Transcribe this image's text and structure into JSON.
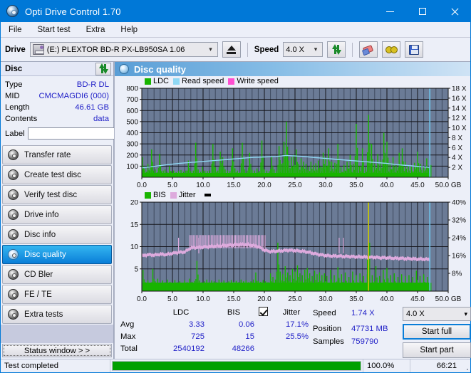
{
  "window": {
    "title": "Opti Drive Control 1.70",
    "icon": "optical-disc-icon",
    "minimize": "minimize",
    "maximize": "maximize",
    "close": "close"
  },
  "menu": {
    "items": [
      "File",
      "Start test",
      "Extra",
      "Help"
    ]
  },
  "toolbar": {
    "drive_label": "Drive",
    "drive_value": "(E:)   PLEXTOR BD-R  PX-LB950SA 1.06",
    "eject_title": "eject",
    "speed_label": "Speed",
    "speed_value": "4.0 X",
    "refresh_title": "refresh",
    "erase_title": "erase",
    "glasses_title": "bookmark",
    "save_title": "save"
  },
  "disc": {
    "header": "Disc",
    "refresh_title": "refresh-disc",
    "fields": [
      {
        "key": "Type",
        "value": "BD-R DL"
      },
      {
        "key": "MID",
        "value": "CMCMAGDI6 (000)"
      },
      {
        "key": "Length",
        "value": "46.61 GB"
      },
      {
        "key": "Contents",
        "value": "data"
      }
    ],
    "label_key": "Label",
    "label_value": "",
    "label_placeholder": ""
  },
  "nav": {
    "items": [
      {
        "label": "Transfer rate",
        "active": false
      },
      {
        "label": "Create test disc",
        "active": false
      },
      {
        "label": "Verify test disc",
        "active": false
      },
      {
        "label": "Drive info",
        "active": false
      },
      {
        "label": "Disc info",
        "active": false
      },
      {
        "label": "Disc quality",
        "active": true
      },
      {
        "label": "CD Bler",
        "active": false
      },
      {
        "label": "FE / TE",
        "active": false
      },
      {
        "label": "Extra tests",
        "active": false
      }
    ],
    "status_window": "Status window > >"
  },
  "panel": {
    "title": "Disc quality",
    "icon": "disc-quality-icon"
  },
  "colors": {
    "ldc": "#18b400",
    "bis": "#18b400",
    "read_speed": "#8fd8f4",
    "write_speed": "#ff4fd0",
    "jitter": "#ddaadd",
    "plot_bg": "#6b7b96",
    "grid": "#2a2a2a",
    "accent": "#0078d7",
    "value_text": "#2323c8",
    "progress": "#00a000"
  },
  "chart_data": [
    {
      "type": "area",
      "name": "ldc-chart",
      "title": "",
      "legend": [
        {
          "label": "LDC",
          "color": "#18b400"
        },
        {
          "label": "Read speed",
          "color": "#8fd8f4"
        },
        {
          "label": "Write speed",
          "color": "#ff4fd0"
        }
      ],
      "legend_position": "top-left",
      "xlabel": "GB",
      "ylabel": "",
      "xlim": [
        0,
        50
      ],
      "ylim": [
        0,
        800
      ],
      "y2lim": [
        0,
        18
      ],
      "xticks": [
        0.0,
        5.0,
        10.0,
        15.0,
        20.0,
        25.0,
        30.0,
        35.0,
        40.0,
        45.0,
        50.0
      ],
      "xticklabels": [
        "0.0",
        "5.0",
        "10.0",
        "15.0",
        "20.0",
        "25.0",
        "30.0",
        "35.0",
        "40.0",
        "45.0",
        "50.0 GB"
      ],
      "yticks": [
        100,
        200,
        300,
        400,
        500,
        600,
        700,
        800
      ],
      "yticklabels": [
        "100",
        "200",
        "300",
        "400",
        "500",
        "600",
        "700",
        "800"
      ],
      "y2ticks": [
        2,
        4,
        6,
        8,
        10,
        12,
        14,
        16,
        18
      ],
      "y2ticklabels": [
        "2 X",
        "4 X",
        "6 X",
        "8 X",
        "10 X",
        "12 X",
        "14 X",
        "16 X",
        "18 X"
      ],
      "grid": true,
      "data_end_gb": 47.0,
      "series": [
        {
          "name": "LDC",
          "color": "#18b400",
          "axis": "left",
          "kind": "spikes",
          "x": [
            0.1,
            0.3,
            0.5,
            0.8,
            1.0,
            1.3,
            1.6,
            1.9,
            2.2,
            2.5,
            2.9,
            3.2,
            3.5,
            3.8,
            4.1,
            4.5,
            4.8,
            5.2,
            5.6,
            6.0,
            6.4,
            6.8,
            7.2,
            7.6,
            8.0,
            8.4,
            8.8,
            9.2,
            9.6,
            9.9,
            10.3,
            10.7,
            11.1,
            11.6,
            12.0,
            12.4,
            12.8,
            13.2,
            13.6,
            14.0,
            14.4,
            14.8,
            15.2,
            15.6,
            16.0,
            16.4,
            16.8,
            17.2,
            17.6,
            18.0,
            18.4,
            18.8,
            19.2,
            19.6,
            20.0,
            20.4,
            20.8,
            21.2,
            21.6,
            22.0,
            22.4,
            22.8,
            23.2,
            23.6,
            24.0,
            24.4,
            24.8,
            25.2,
            25.6,
            26.0,
            26.4,
            26.8,
            27.2,
            27.6,
            28.0,
            28.4,
            28.8,
            29.2,
            29.6,
            30.0,
            30.5,
            31.0,
            31.5,
            32.0,
            32.5,
            33.0,
            33.5,
            34.0,
            34.5,
            35.0,
            35.5,
            36.0,
            36.5,
            37.0,
            37.5,
            38.0,
            38.5,
            39.0,
            39.5,
            40.0,
            40.5,
            41.0,
            41.5,
            42.0,
            42.5,
            43.0,
            43.5,
            44.0,
            44.5,
            45.0,
            45.5,
            46.0,
            46.5,
            47.0
          ],
          "y": [
            180,
            60,
            75,
            50,
            120,
            55,
            250,
            60,
            70,
            45,
            210,
            55,
            60,
            70,
            50,
            100,
            55,
            60,
            45,
            55,
            65,
            50,
            60,
            150,
            55,
            60,
            310,
            70,
            50,
            95,
            60,
            55,
            60,
            300,
            90,
            60,
            230,
            180,
            70,
            60,
            55,
            260,
            80,
            60,
            45,
            310,
            70,
            60,
            220,
            65,
            60,
            80,
            55,
            330,
            70,
            60,
            55,
            190,
            70,
            60,
            280,
            120,
            320,
            500,
            150,
            180,
            200,
            250,
            120,
            170,
            140,
            120,
            95,
            140,
            110,
            125,
            150,
            100,
            220,
            180,
            260,
            140,
            130,
            300,
            90,
            110,
            140,
            200,
            120,
            480,
            100,
            260,
            90,
            560,
            300,
            120,
            210,
            150,
            400,
            320,
            130,
            180,
            110,
            220,
            260,
            140,
            110,
            95,
            130,
            230,
            120,
            100,
            170,
            200
          ]
        },
        {
          "name": "Read speed",
          "color": "#8fd8f4",
          "axis": "right",
          "kind": "line",
          "x": [
            0.0,
            2.0,
            4.0,
            6.0,
            8.0,
            10.0,
            12.0,
            14.0,
            16.0,
            18.0,
            20.0,
            22.0,
            23.5,
            25.0,
            26.5,
            28.0,
            30.0,
            32.0,
            34.0,
            36.0,
            38.0,
            40.0,
            42.0,
            44.0,
            46.0,
            47.0
          ],
          "y": [
            1.9,
            2.2,
            2.5,
            2.8,
            3.0,
            3.2,
            3.4,
            3.6,
            3.8,
            4.0,
            4.1,
            4.2,
            4.4,
            4.3,
            4.2,
            4.0,
            3.8,
            3.6,
            3.4,
            3.2,
            3.0,
            2.8,
            2.5,
            2.3,
            2.1,
            2.0
          ]
        },
        {
          "name": "Write speed",
          "color": "#ff4fd0",
          "axis": "right",
          "kind": "line",
          "x": [],
          "y": []
        }
      ],
      "markers": [
        {
          "type": "vline",
          "x": 47.0,
          "color": "#6ec8ee"
        }
      ]
    },
    {
      "type": "area",
      "name": "bis-jitter-chart",
      "title": "",
      "legend": [
        {
          "label": "BIS",
          "color": "#18b400"
        },
        {
          "label": "Jitter",
          "color": "#ddaadd"
        }
      ],
      "legend_position": "top-left",
      "xlabel": "GB",
      "ylabel": "",
      "xlim": [
        0,
        50
      ],
      "ylim": [
        0,
        20
      ],
      "y2lim": [
        0,
        40
      ],
      "xticks": [
        0.0,
        5.0,
        10.0,
        15.0,
        20.0,
        25.0,
        30.0,
        35.0,
        40.0,
        45.0,
        50.0
      ],
      "xticklabels": [
        "0.0",
        "5.0",
        "10.0",
        "15.0",
        "20.0",
        "25.0",
        "30.0",
        "35.0",
        "40.0",
        "45.0",
        "50.0 GB"
      ],
      "yticks": [
        5,
        10,
        15,
        20
      ],
      "yticklabels": [
        "5",
        "10",
        "15",
        "20"
      ],
      "y2ticks": [
        8,
        16,
        24,
        32,
        40
      ],
      "y2ticklabels": [
        "8%",
        "16%",
        "24%",
        "32%",
        "40%"
      ],
      "grid": true,
      "data_end_gb": 47.0,
      "series": [
        {
          "name": "BIS",
          "color": "#18b400",
          "axis": "left",
          "kind": "spikes",
          "x": [
            0.2,
            0.6,
            1.0,
            1.4,
            1.8,
            2.2,
            2.6,
            3.0,
            3.4,
            3.8,
            4.2,
            4.6,
            5.0,
            5.4,
            5.8,
            6.2,
            6.6,
            7.0,
            7.4,
            7.8,
            8.2,
            8.6,
            9.0,
            9.4,
            9.8,
            10.2,
            10.6,
            11.0,
            11.4,
            11.8,
            12.2,
            12.6,
            13.0,
            13.4,
            13.8,
            14.2,
            14.6,
            15.0,
            15.4,
            15.8,
            16.2,
            16.6,
            17.0,
            17.4,
            17.8,
            18.2,
            18.6,
            19.0,
            19.4,
            19.8,
            20.2,
            20.6,
            21.0,
            21.4,
            21.8,
            22.2,
            22.6,
            23.0,
            23.4,
            23.8,
            24.2,
            24.6,
            25.0,
            25.4,
            25.8,
            26.2,
            26.6,
            27.0,
            27.4,
            27.8,
            28.2,
            28.6,
            29.0,
            29.4,
            29.8,
            30.2,
            30.8,
            31.4,
            32.0,
            32.6,
            33.2,
            33.8,
            34.4,
            35.0,
            35.6,
            36.2,
            36.8,
            37.0,
            37.6,
            38.2,
            38.8,
            39.4,
            40.0,
            40.6,
            41.2,
            41.8,
            42.4,
            43.0,
            43.6,
            44.2,
            44.8,
            45.4,
            46.0,
            46.6,
            47.0
          ],
          "y": [
            4.8,
            2.0,
            2.4,
            1.9,
            5.0,
            2.2,
            2.8,
            1.8,
            2.4,
            2.0,
            2.6,
            2.1,
            1.9,
            2.5,
            2.0,
            2.2,
            1.9,
            2.4,
            2.0,
            2.8,
            2.1,
            2.3,
            6.8,
            2.4,
            2.0,
            2.2,
            2.6,
            2.0,
            2.4,
            2.2,
            2.0,
            2.6,
            2.1,
            2.4,
            2.0,
            2.2,
            2.5,
            2.1,
            2.3,
            2.0,
            2.6,
            2.2,
            2.4,
            2.0,
            2.2,
            2.6,
            4.2,
            2.3,
            2.1,
            2.5,
            2.2,
            2.0,
            4.0,
            3.2,
            2.6,
            10.9,
            4.4,
            3.8,
            5.6,
            4.2,
            3.6,
            5.0,
            4.4,
            5.8,
            4.0,
            3.6,
            4.8,
            5.2,
            4.0,
            3.4,
            4.6,
            3.8,
            4.2,
            3.6,
            4.0,
            3.4,
            4.8,
            3.6,
            5.4,
            3.8,
            4.2,
            3.2,
            4.4,
            3.6,
            4.0,
            3.4,
            3.8,
            19.8,
            3.6,
            5.6,
            3.4,
            4.8,
            5.2,
            3.6,
            4.0,
            3.2,
            3.8,
            3.4,
            3.6,
            3.2,
            4.6,
            3.4,
            3.8,
            3.2,
            3.4
          ]
        },
        {
          "name": "Jitter",
          "color": "#ddaadd",
          "axis": "right",
          "kind": "band",
          "x": [
            0.0,
            1.0,
            2.0,
            3.0,
            4.0,
            5.0,
            6.0,
            7.0,
            8.0,
            9.0,
            10.0,
            11.0,
            12.0,
            13.0,
            14.0,
            15.0,
            16.0,
            17.0,
            18.0,
            19.0,
            20.0,
            21.0,
            22.0,
            23.0,
            24.0,
            25.0,
            26.0,
            27.0,
            28.0,
            29.0,
            30.0,
            31.0,
            32.0,
            33.0,
            34.0,
            35.0,
            36.0,
            37.0,
            38.0,
            39.0,
            40.0,
            41.0,
            42.0,
            43.0,
            44.0,
            45.0,
            46.0,
            47.0
          ],
          "y": [
            15.8,
            16.4,
            16.2,
            16.6,
            16.4,
            17.0,
            17.4,
            17.6,
            19.4,
            19.6,
            19.8,
            20.0,
            20.2,
            20.4,
            20.6,
            20.8,
            21.0,
            21.0,
            20.6,
            20.0,
            18.4,
            17.8,
            18.0,
            18.2,
            18.4,
            18.2,
            18.0,
            17.6,
            17.0,
            16.4,
            16.0,
            15.8,
            15.8,
            15.6,
            15.6,
            15.4,
            15.4,
            15.2,
            15.2,
            15.0,
            15.0,
            14.8,
            14.8,
            14.6,
            14.6,
            14.4,
            14.4,
            14.2
          ]
        }
      ],
      "markers": [
        {
          "type": "vline",
          "x": 37.0,
          "color": "#c8c800"
        },
        {
          "type": "vline",
          "x": 47.0,
          "color": "#6ec8ee"
        }
      ]
    }
  ],
  "stats": {
    "col_headers": [
      "",
      "LDC",
      "BIS"
    ],
    "jitter_label": "Jitter",
    "jitter_checked": true,
    "rows": [
      {
        "label": "Avg",
        "ldc": "3.33",
        "bis": "0.06",
        "jitter": "17.1%"
      },
      {
        "label": "Max",
        "ldc": "725",
        "bis": "15",
        "jitter": "25.5%"
      },
      {
        "label": "Total",
        "ldc": "2540192",
        "bis": "48266",
        "jitter": ""
      }
    ]
  },
  "test_info": {
    "speed_label": "Speed",
    "speed_value": "1.74 X",
    "position_label": "Position",
    "position_value": "47731 MB",
    "samples_label": "Samples",
    "samples_value": "759790",
    "speed_select_value": "4.0 X",
    "start_full": "Start full",
    "start_part": "Start part"
  },
  "statusbar": {
    "message": "Test completed",
    "progress_percent": 100.0,
    "progress_text": "100.0%",
    "elapsed": "66:21"
  }
}
